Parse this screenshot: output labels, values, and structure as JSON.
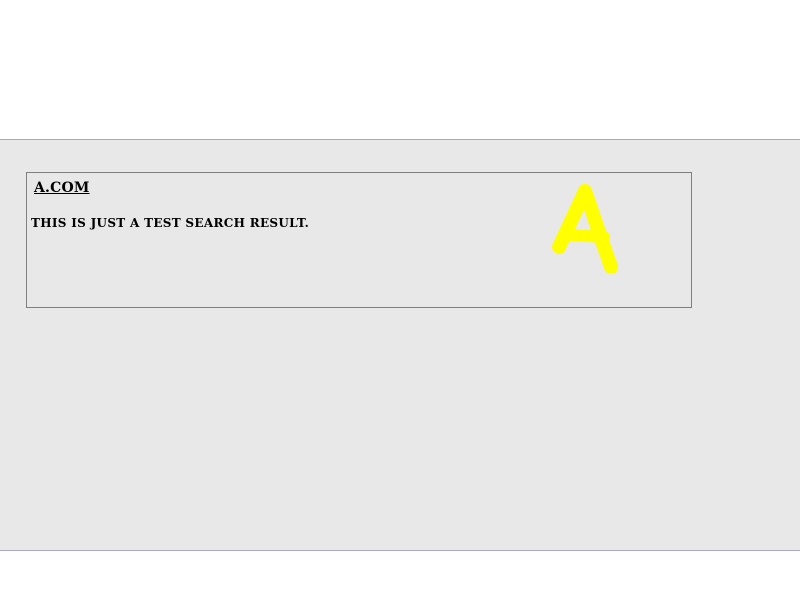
{
  "search_results": [
    {
      "title": "A.COM",
      "snippet": "THIS IS JUST A TEST SEARCH RESULT.",
      "logo_text": "A",
      "logo_color": "#ffff00"
    }
  ],
  "colors": {
    "panel_background": "#e8e8e8",
    "panel_border": "#a9a6cf",
    "card_border": "#7f7f7f"
  }
}
